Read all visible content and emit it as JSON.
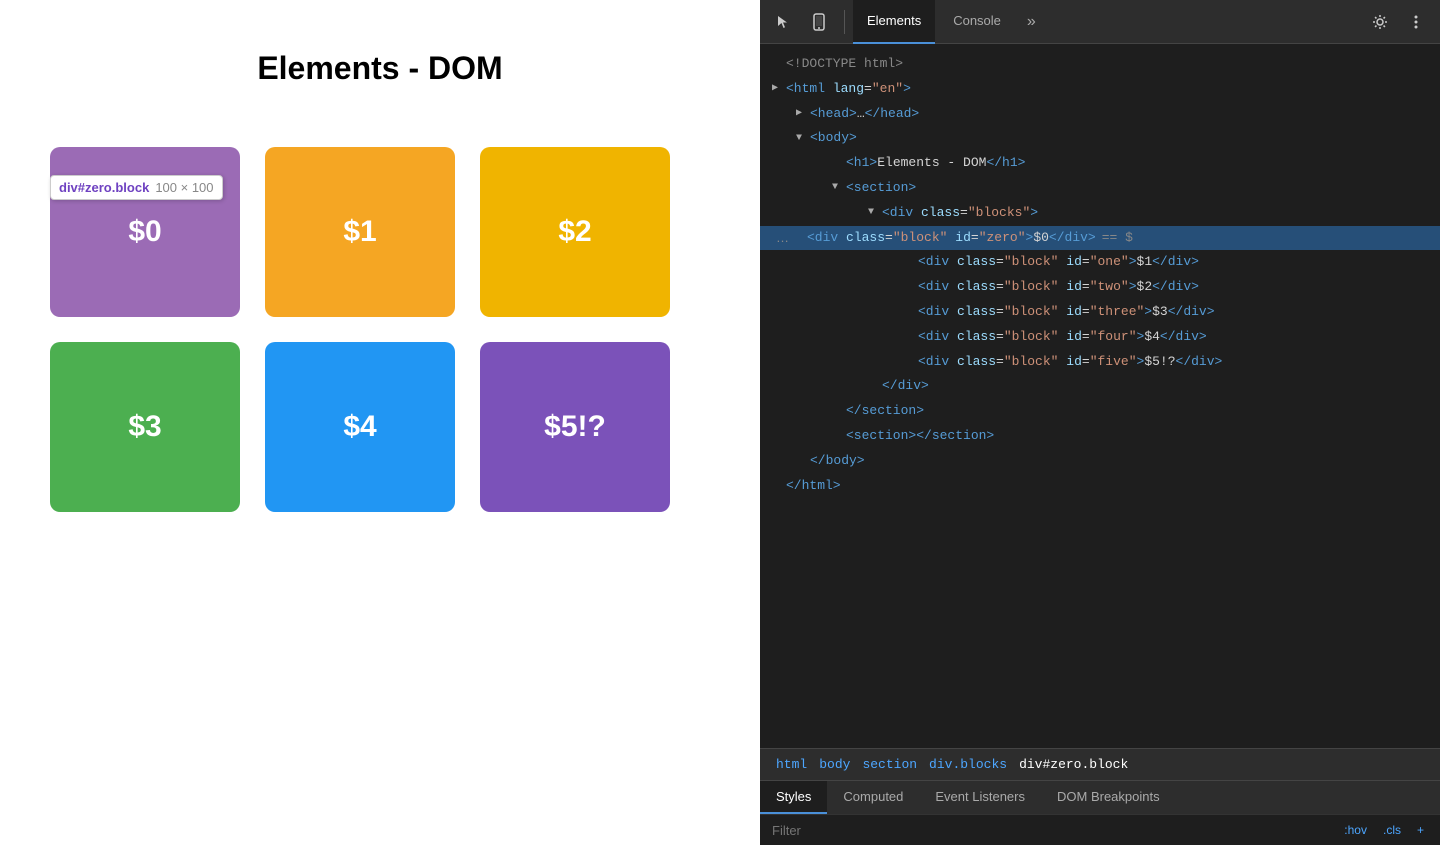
{
  "page": {
    "title": "Elements - DOM"
  },
  "blocks": [
    {
      "id": "zero",
      "label": "$0",
      "colorClass": "block-zero"
    },
    {
      "id": "one",
      "label": "$1",
      "colorClass": "block-one"
    },
    {
      "id": "two",
      "label": "$2",
      "colorClass": "block-two"
    },
    {
      "id": "three",
      "label": "$3",
      "colorClass": "block-three"
    },
    {
      "id": "four",
      "label": "$4",
      "colorClass": "block-four"
    },
    {
      "id": "five",
      "label": "$5!?",
      "colorClass": "block-five"
    }
  ],
  "tooltip": {
    "id": "div#zero.block",
    "size": "100 × 100"
  },
  "devtools": {
    "tabs": [
      "Elements",
      "Console",
      "»"
    ],
    "active_tab": "Elements",
    "dom_lines": [
      {
        "text": "<!DOCTYPE html>",
        "indent": 0,
        "type": "doctype"
      },
      {
        "text": "<html lang=\"en\">",
        "indent": 0,
        "type": "open-tag",
        "triangle": "closed"
      },
      {
        "text": "▶ <head>…</head>",
        "indent": 1,
        "type": "collapsed"
      },
      {
        "text": "▼ <body>",
        "indent": 1,
        "type": "open",
        "triangle": "open"
      },
      {
        "text": "<h1>Elements - DOM</h1>",
        "indent": 2,
        "type": "leaf"
      },
      {
        "text": "▼ <section>",
        "indent": 2,
        "type": "open",
        "triangle": "open"
      },
      {
        "text": "▼ <div class=\"blocks\">",
        "indent": 3,
        "type": "open",
        "triangle": "open"
      },
      {
        "text": "<div class=\"block\" id=\"zero\">$0</div> == $",
        "indent": 4,
        "type": "highlighted",
        "extra": "≡"
      },
      {
        "text": "<div class=\"block\" id=\"one\">$1</div>",
        "indent": 4,
        "type": "leaf"
      },
      {
        "text": "<div class=\"block\" id=\"two\">$2</div>",
        "indent": 4,
        "type": "leaf"
      },
      {
        "text": "<div class=\"block\" id=\"three\">$3</div>",
        "indent": 4,
        "type": "leaf"
      },
      {
        "text": "<div class=\"block\" id=\"four\">$4</div>",
        "indent": 4,
        "type": "leaf"
      },
      {
        "text": "<div class=\"block\" id=\"five\">$5!?</div>",
        "indent": 4,
        "type": "leaf"
      },
      {
        "text": "</div>",
        "indent": 3,
        "type": "close"
      },
      {
        "text": "</section>",
        "indent": 2,
        "type": "close"
      },
      {
        "text": "<section></section>",
        "indent": 2,
        "type": "leaf"
      },
      {
        "text": "</body>",
        "indent": 1,
        "type": "close"
      },
      {
        "text": "</html>",
        "indent": 0,
        "type": "close"
      }
    ],
    "breadcrumb": [
      "html",
      "body",
      "section",
      "div.blocks",
      "div#zero.block"
    ],
    "inner_tabs": [
      "Styles",
      "Computed",
      "Event Listeners",
      "DOM Breakpoints"
    ],
    "active_inner_tab": "Styles",
    "filter_placeholder": "Filter",
    "filter_options": [
      ":hov",
      ".cls",
      "+"
    ]
  }
}
